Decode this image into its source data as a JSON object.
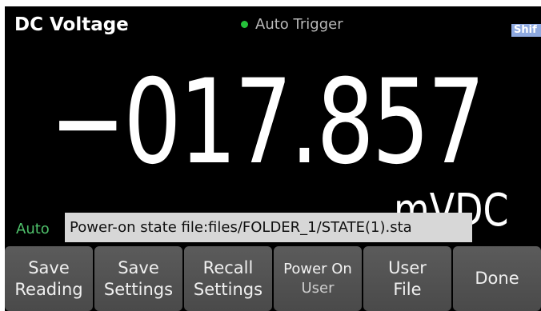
{
  "header": {
    "title": "DC Voltage",
    "trigger_status": "Auto Trigger",
    "trigger_indicator_color": "#25c13a",
    "shift_label": "Shif"
  },
  "measurement": {
    "reading": "−017.857",
    "unit": "mVDC",
    "range_mode": "Auto"
  },
  "message_bar": {
    "text": "Power-on state file:files/FOLDER_1/STATE(1).sta"
  },
  "softkeys": [
    {
      "line1": "Save",
      "line2": "Reading"
    },
    {
      "line1": "Save",
      "line2": "Settings"
    },
    {
      "line1": "Recall",
      "line2": "Settings"
    },
    {
      "line1": "Power On",
      "line2": "User"
    },
    {
      "line1": "User",
      "line2": "File"
    },
    {
      "line1": "Done",
      "line2": ""
    }
  ]
}
